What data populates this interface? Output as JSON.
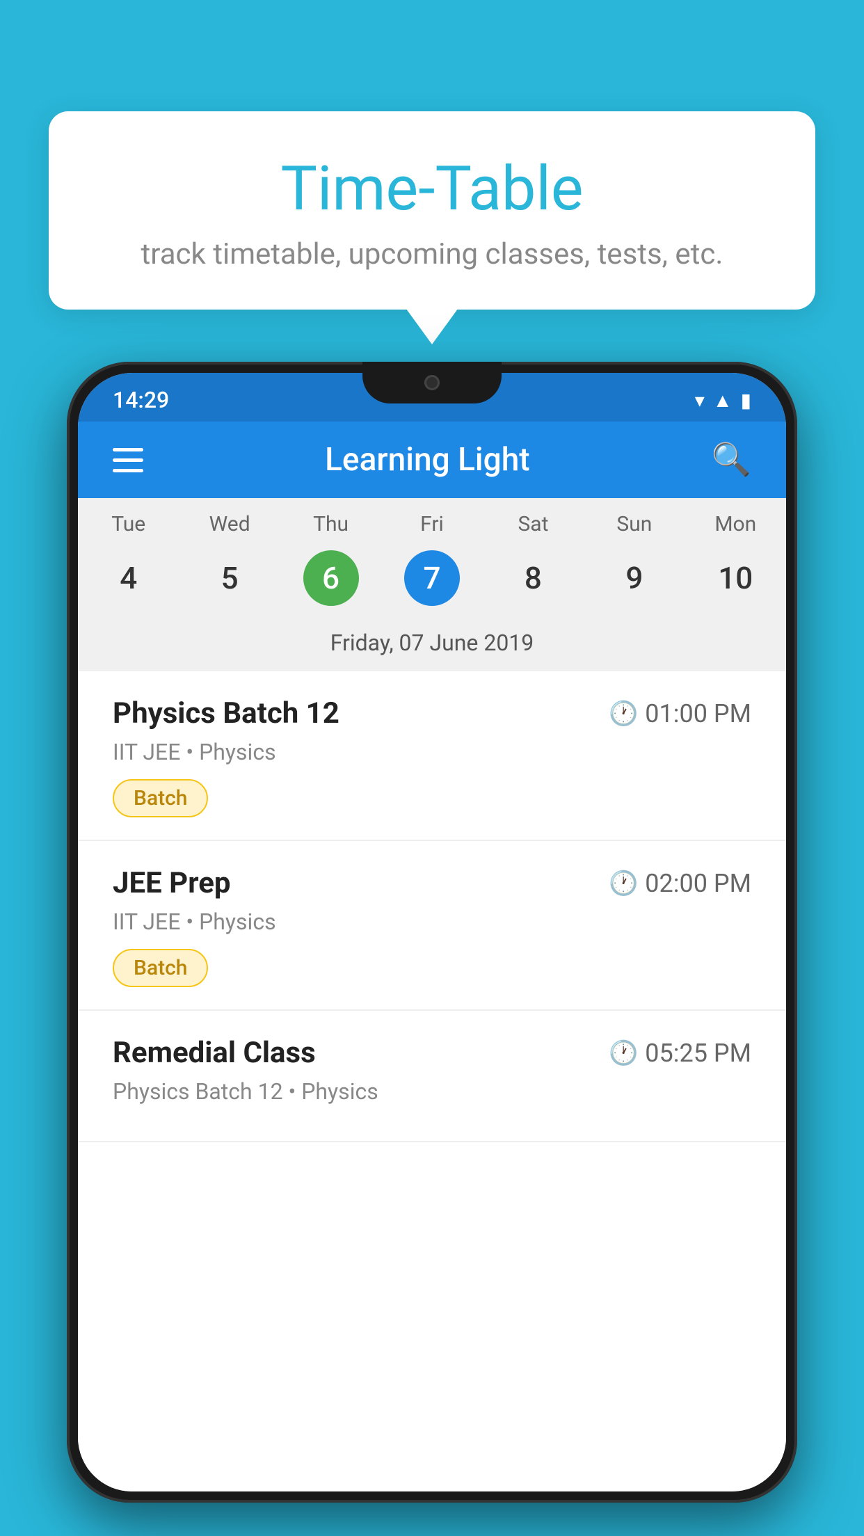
{
  "background_color": "#29B6D8",
  "tooltip": {
    "title": "Time-Table",
    "subtitle": "track timetable, upcoming classes, tests, etc."
  },
  "phone": {
    "status_bar": {
      "time": "14:29"
    },
    "app_bar": {
      "title": "Learning Light"
    },
    "calendar": {
      "days": [
        "Tue",
        "Wed",
        "Thu",
        "Fri",
        "Sat",
        "Sun",
        "Mon"
      ],
      "dates": [
        "4",
        "5",
        "6",
        "7",
        "8",
        "9",
        "10"
      ],
      "today_index": 2,
      "selected_index": 3,
      "selected_date_label": "Friday, 07 June 2019"
    },
    "schedule": [
      {
        "title": "Physics Batch 12",
        "time": "01:00 PM",
        "subtitle": "IIT JEE • Physics",
        "badge": "Batch"
      },
      {
        "title": "JEE Prep",
        "time": "02:00 PM",
        "subtitle": "IIT JEE • Physics",
        "badge": "Batch"
      },
      {
        "title": "Remedial Class",
        "time": "05:25 PM",
        "subtitle": "Physics Batch 12 • Physics",
        "badge": null
      }
    ]
  }
}
